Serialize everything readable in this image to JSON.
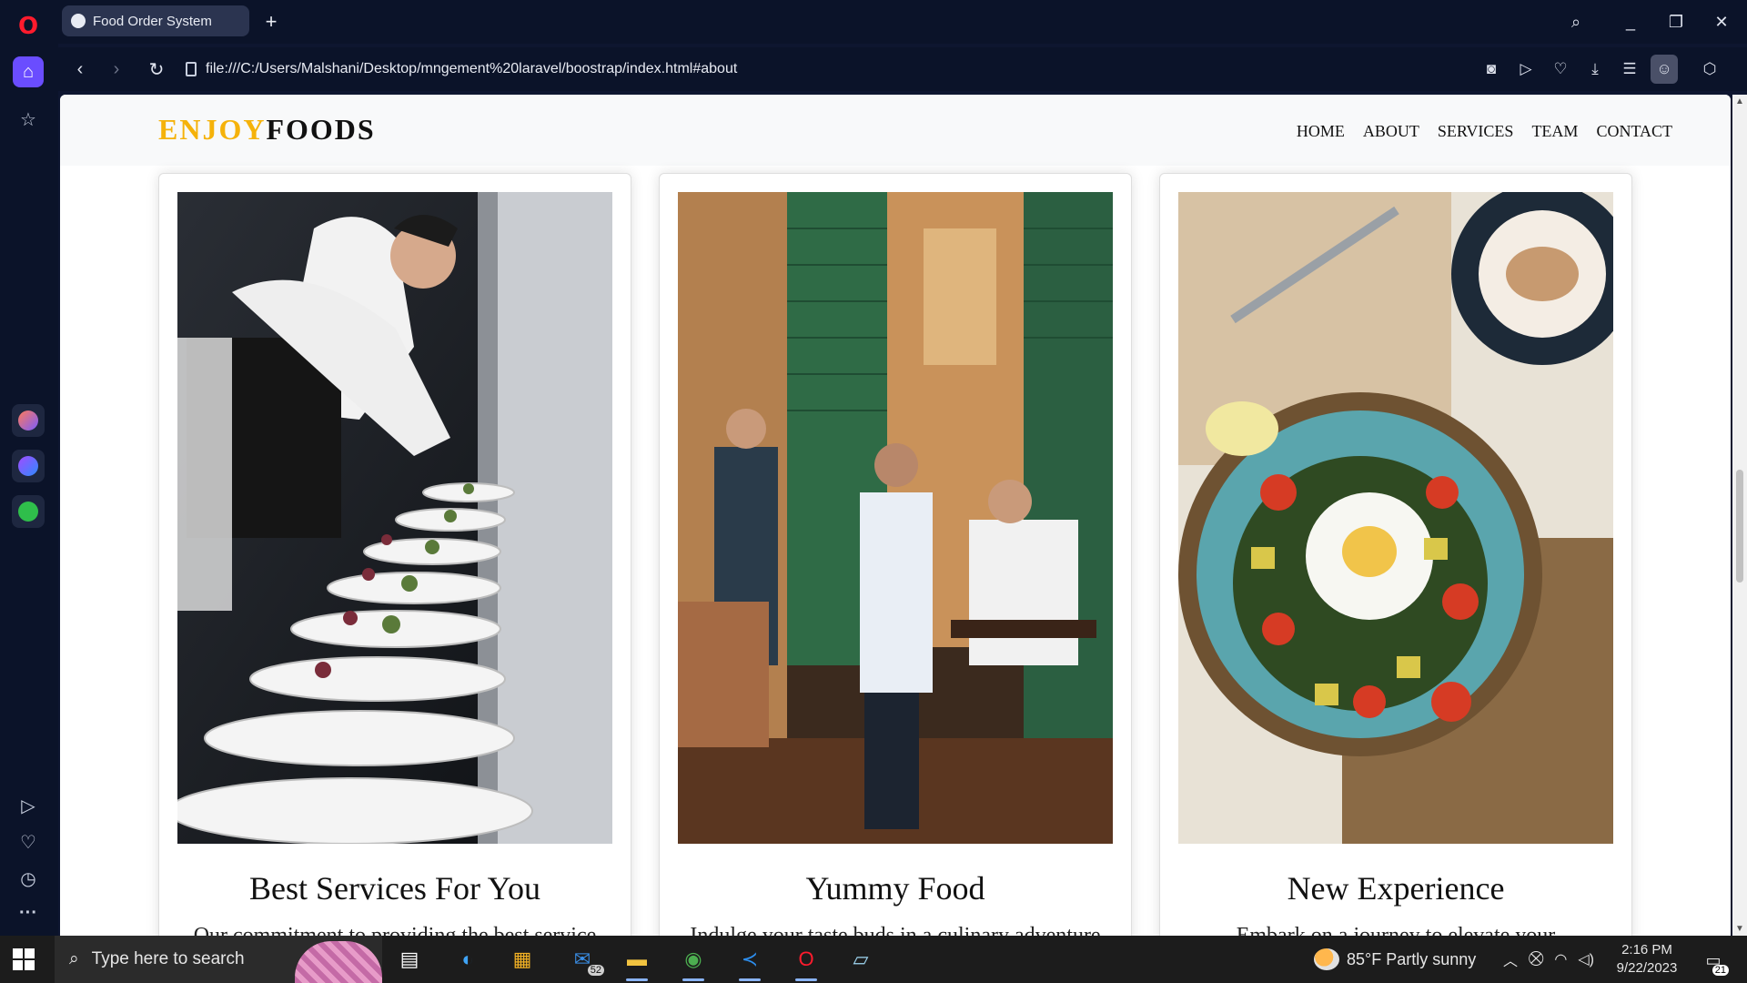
{
  "browser": {
    "tab_title": "Food Order System",
    "new_tab_icon": "plus-icon",
    "url": "file:///C:/Users/Malshani/Desktop/mngement%20laravel/boostrap/index.html#about"
  },
  "site": {
    "brand_accent": "ENJOY",
    "brand_rest": "FOODS",
    "accent_color": "#f5b20a",
    "nav": [
      "HOME",
      "ABOUT",
      "SERVICES",
      "TEAM",
      "CONTACT"
    ]
  },
  "cards": [
    {
      "title": "Best Services For You",
      "text": "Our commitment to providing the best service"
    },
    {
      "title": "Yummy Food",
      "text": "Indulge your taste buds in a culinary adventure"
    },
    {
      "title": "New Experience",
      "text": "Embark on a journey to elevate your"
    }
  ],
  "taskbar": {
    "search_placeholder": "Type here to search",
    "mail_count": "52",
    "weather": "85°F  Partly sunny",
    "time": "2:16 PM",
    "date": "9/22/2023",
    "notifications": "21"
  }
}
